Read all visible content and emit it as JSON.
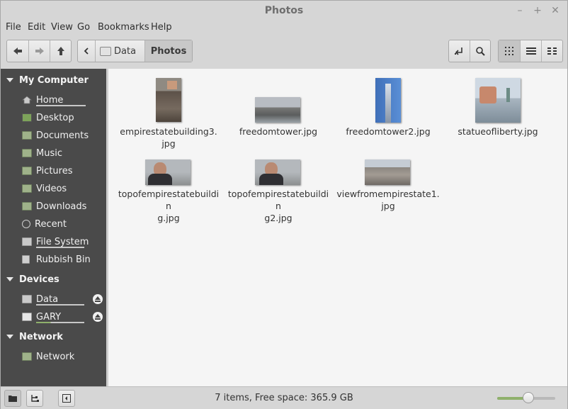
{
  "window": {
    "title": "Photos",
    "controls": [
      "–",
      "+",
      "✕"
    ]
  },
  "menubar": [
    "File",
    "Edit",
    "View",
    "Go",
    "Bookmarks",
    "Help"
  ],
  "toolbar": {
    "back_icon": "arrow-left-icon",
    "forward_icon": "arrow-right-icon",
    "up_icon": "arrow-up-icon",
    "breadcrumb": [
      {
        "label": "Data",
        "icon": "drive-icon"
      },
      {
        "label": "Photos",
        "active": true
      }
    ],
    "views": [
      "icon-view",
      "list-view",
      "compact-view"
    ],
    "active_view": "icon-view"
  },
  "sidebar": {
    "sections": [
      {
        "title": "My Computer",
        "items": [
          {
            "label": "Home",
            "icon": "home-icon",
            "underline": true
          },
          {
            "label": "Desktop",
            "icon": "desktop-icon"
          },
          {
            "label": "Documents",
            "icon": "folder-icon"
          },
          {
            "label": "Music",
            "icon": "music-folder-icon"
          },
          {
            "label": "Pictures",
            "icon": "pictures-folder-icon"
          },
          {
            "label": "Videos",
            "icon": "videos-folder-icon"
          },
          {
            "label": "Downloads",
            "icon": "downloads-folder-icon"
          },
          {
            "label": "Recent",
            "icon": "recent-icon"
          },
          {
            "label": "File System",
            "icon": "drive-icon",
            "underline": true
          },
          {
            "label": "Rubbish Bin",
            "icon": "trash-icon"
          }
        ]
      },
      {
        "title": "Devices",
        "items": [
          {
            "label": "Data",
            "icon": "drive-icon",
            "underline": true,
            "eject": true
          },
          {
            "label": "GARY",
            "icon": "usb-drive-icon",
            "underline": true,
            "eject": true
          }
        ]
      },
      {
        "title": "Network",
        "items": [
          {
            "label": "Network",
            "icon": "network-folder-icon"
          }
        ]
      }
    ]
  },
  "files": [
    {
      "name": "empirestatebuilding3.jpg",
      "lines": [
        "empirestatebuilding3.",
        "jpg"
      ]
    },
    {
      "name": "freedomtower.jpg",
      "lines": [
        "freedomtower.jpg"
      ]
    },
    {
      "name": "freedomtower2.jpg",
      "lines": [
        "freedomtower2.jpg"
      ]
    },
    {
      "name": "statueofliberty.jpg",
      "lines": [
        "statueofliberty.jpg"
      ]
    },
    {
      "name": "topofempirestatebuilding.jpg",
      "lines": [
        "topofempirestatebuildin",
        "g.jpg"
      ]
    },
    {
      "name": "topofempirestatebuilding2.jpg",
      "lines": [
        "topofempirestatebuildin",
        "g2.jpg"
      ]
    },
    {
      "name": "viewfromempirestate1.jpg",
      "lines": [
        "viewfromempirestate1.",
        "jpg"
      ]
    }
  ],
  "status": {
    "text": "7 items, Free space: 365.9 GB"
  },
  "zoom": {
    "level": 0.55
  },
  "colors": {
    "sidebar_bg": "#4a4a4a",
    "accent": "#8fb06c",
    "main_bg": "#f5f5f5"
  }
}
